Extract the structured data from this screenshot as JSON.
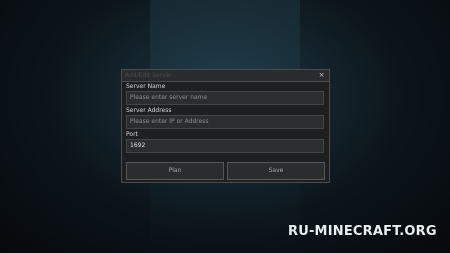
{
  "dialog": {
    "title": "Add/Edit Server",
    "close_glyph": "×",
    "fields": [
      {
        "label": "Server Name",
        "placeholder": "Please enter server name",
        "value": ""
      },
      {
        "label": "Server Address",
        "placeholder": "Please enter IP or Address",
        "value": ""
      },
      {
        "label": "Port",
        "placeholder": "",
        "value": "1692"
      }
    ],
    "buttons": {
      "plan_label": "Plan",
      "save_label": "Save"
    }
  },
  "watermark": "RU-MINECRAFT.ORG"
}
